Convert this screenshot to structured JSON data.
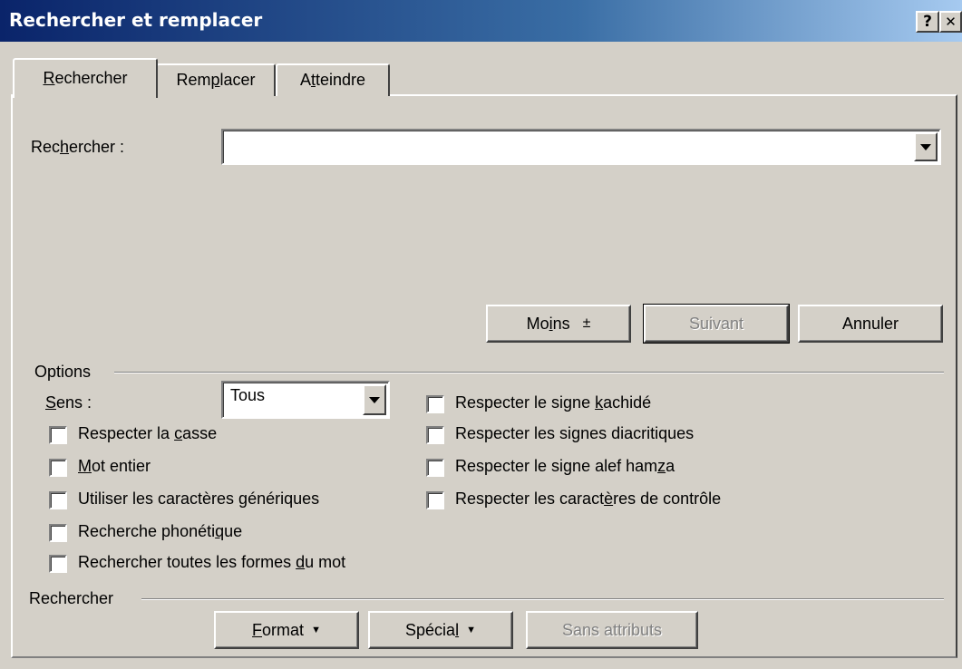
{
  "window": {
    "title": "Rechercher et remplacer",
    "help_label": "?",
    "close_label": "✕"
  },
  "tabs": [
    {
      "pre": "",
      "u": "R",
      "post": "echercher"
    },
    {
      "pre": "Rem",
      "u": "p",
      "post": "lacer"
    },
    {
      "pre": "A",
      "u": "t",
      "post": "teindre"
    }
  ],
  "search": {
    "label_pre": "Rec",
    "label_u": "h",
    "label_post": "ercher :",
    "value": ""
  },
  "buttons": {
    "less": {
      "pre": "Mo",
      "u": "i",
      "post": "ns",
      "arrow": "±"
    },
    "next": "Suivant",
    "cancel": "Annuler"
  },
  "options": {
    "group_label": "Options",
    "direction": {
      "label_u": "S",
      "label_post": "ens :",
      "value": "Tous"
    },
    "left_checks": [
      {
        "pre": "Respecter la ",
        "u": "c",
        "post": "asse",
        "checked": false
      },
      {
        "pre": "",
        "u": "M",
        "post": "ot entier",
        "checked": false
      },
      {
        "pre": "Utiliser les caractères ",
        "u": "g",
        "post": "énériques",
        "checked": false
      },
      {
        "pre": "Recherche phonéti",
        "u": "q",
        "post": "ue",
        "checked": false
      },
      {
        "pre": "Rechercher toutes les formes ",
        "u": "d",
        "post": "u mot",
        "checked": false
      }
    ],
    "right_checks": [
      {
        "pre": "Respecter le signe ",
        "u": "k",
        "post": "achidé",
        "checked": false
      },
      {
        "pre": "Respecter les si",
        "u": "g",
        "post": "nes diacritiques",
        "checked": false
      },
      {
        "pre": "Respecter le signe alef ham",
        "u": "z",
        "post": "a",
        "checked": false
      },
      {
        "pre": "Respecter les caract",
        "u": "è",
        "post": "res de contrôle",
        "checked": false
      }
    ]
  },
  "find_group": {
    "label": "Rechercher",
    "format": {
      "pre": "",
      "u": "F",
      "post": "ormat"
    },
    "special": {
      "pre": "Spécia",
      "u": "l",
      "post": ""
    },
    "no_attr": "Sans attributs"
  }
}
